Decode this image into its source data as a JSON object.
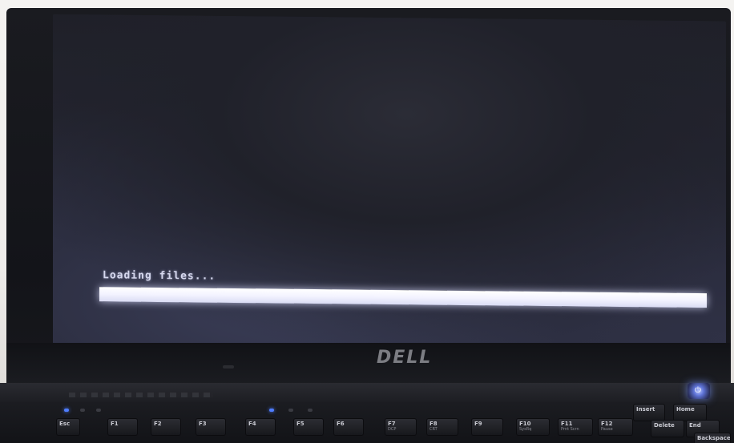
{
  "screen": {
    "loading_text": "Loading files...",
    "progress_percent": 100
  },
  "brand": {
    "logo_text": "DELL"
  },
  "keyboard": {
    "keys": [
      {
        "label": "Esc",
        "sub": ""
      },
      {
        "label": "F1",
        "sub": ""
      },
      {
        "label": "F2",
        "sub": ""
      },
      {
        "label": "F3",
        "sub": ""
      },
      {
        "label": "F4",
        "sub": ""
      },
      {
        "label": "F5",
        "sub": ""
      },
      {
        "label": "F6",
        "sub": ""
      },
      {
        "label": "F7",
        "sub": "DCP"
      },
      {
        "label": "F8",
        "sub": "CRT"
      },
      {
        "label": "F9",
        "sub": ""
      },
      {
        "label": "F10",
        "sub": "SysRq"
      },
      {
        "label": "F11",
        "sub": "Prnt Scrn"
      },
      {
        "label": "F12",
        "sub": "Pause"
      },
      {
        "label": "Insert",
        "sub": ""
      },
      {
        "label": "Home",
        "sub": ""
      },
      {
        "label": "Delete",
        "sub": ""
      },
      {
        "label": "End",
        "sub": ""
      },
      {
        "label": "Backspace",
        "sub": ""
      }
    ]
  },
  "colors": {
    "screen_text": "#d6d8ee",
    "progress_fill": "#ffffff",
    "power_led": "#5f74d8"
  }
}
